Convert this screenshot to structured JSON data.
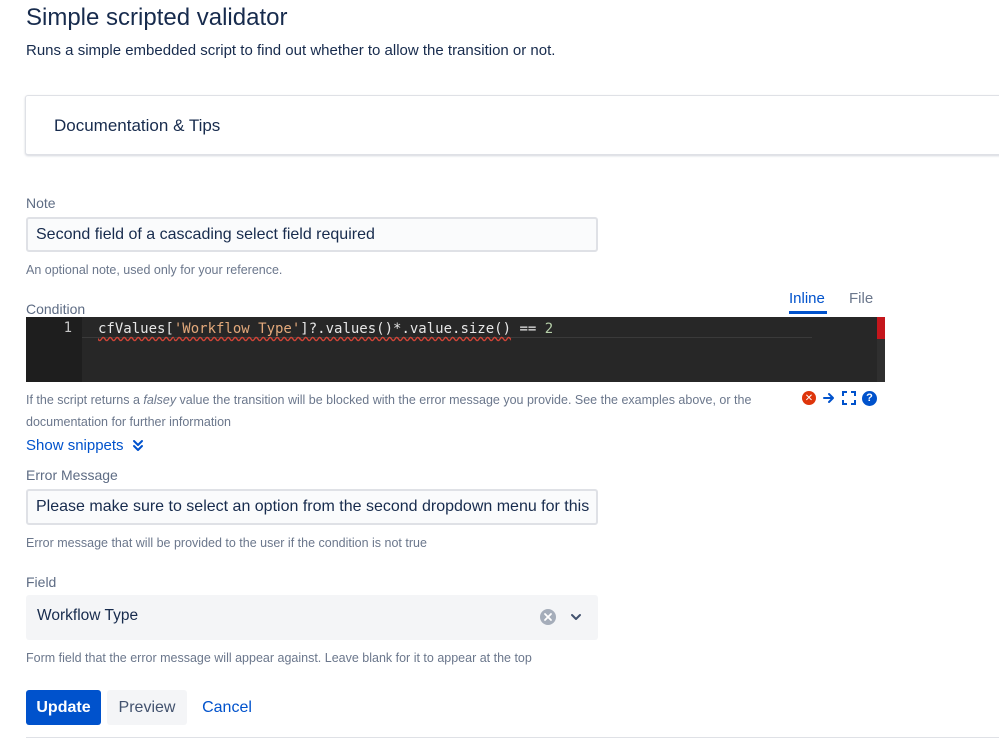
{
  "header": {
    "title": "Simple scripted validator",
    "description": "Runs a simple embedded script to find out whether to allow the transition or not."
  },
  "docs_panel": {
    "label": "Documentation & Tips"
  },
  "note": {
    "label": "Note",
    "value": "Second field of a cascading select field required",
    "help": "An optional note, used only for your reference."
  },
  "condition": {
    "label": "Condition",
    "tabs": [
      {
        "label": "Inline",
        "active": true
      },
      {
        "label": "File",
        "active": false
      }
    ],
    "editor": {
      "line_number": "1",
      "code_tokens": {
        "t1": "cfValues[",
        "t2": "'Workflow Type'",
        "t3": "]?.values()*.value.size()",
        "t4": " == ",
        "t5": "2"
      }
    },
    "help_before": "If the script returns a ",
    "help_italic": "falsey",
    "help_after": " value the transition will be blocked with the error message you provide. See the examples above, or the documentation for further information",
    "toolbar_icons": [
      "error-icon",
      "arrow-right-icon",
      "fullscreen-icon",
      "help-icon"
    ]
  },
  "snippets": {
    "label": "Show snippets"
  },
  "error_message": {
    "label": "Error Message",
    "value": "Please make sure to select an option from the second dropdown menu for this",
    "help": "Error message that will be provided to the user if the condition is not true"
  },
  "field": {
    "label": "Field",
    "value": "Workflow Type",
    "help": "Form field that the error message will appear against. Leave blank for it to appear at the top"
  },
  "actions": {
    "update": "Update",
    "preview": "Preview",
    "cancel": "Cancel"
  },
  "colors": {
    "accent": "#0052cc",
    "editor_bg": "#272727",
    "error": "#de350b"
  }
}
